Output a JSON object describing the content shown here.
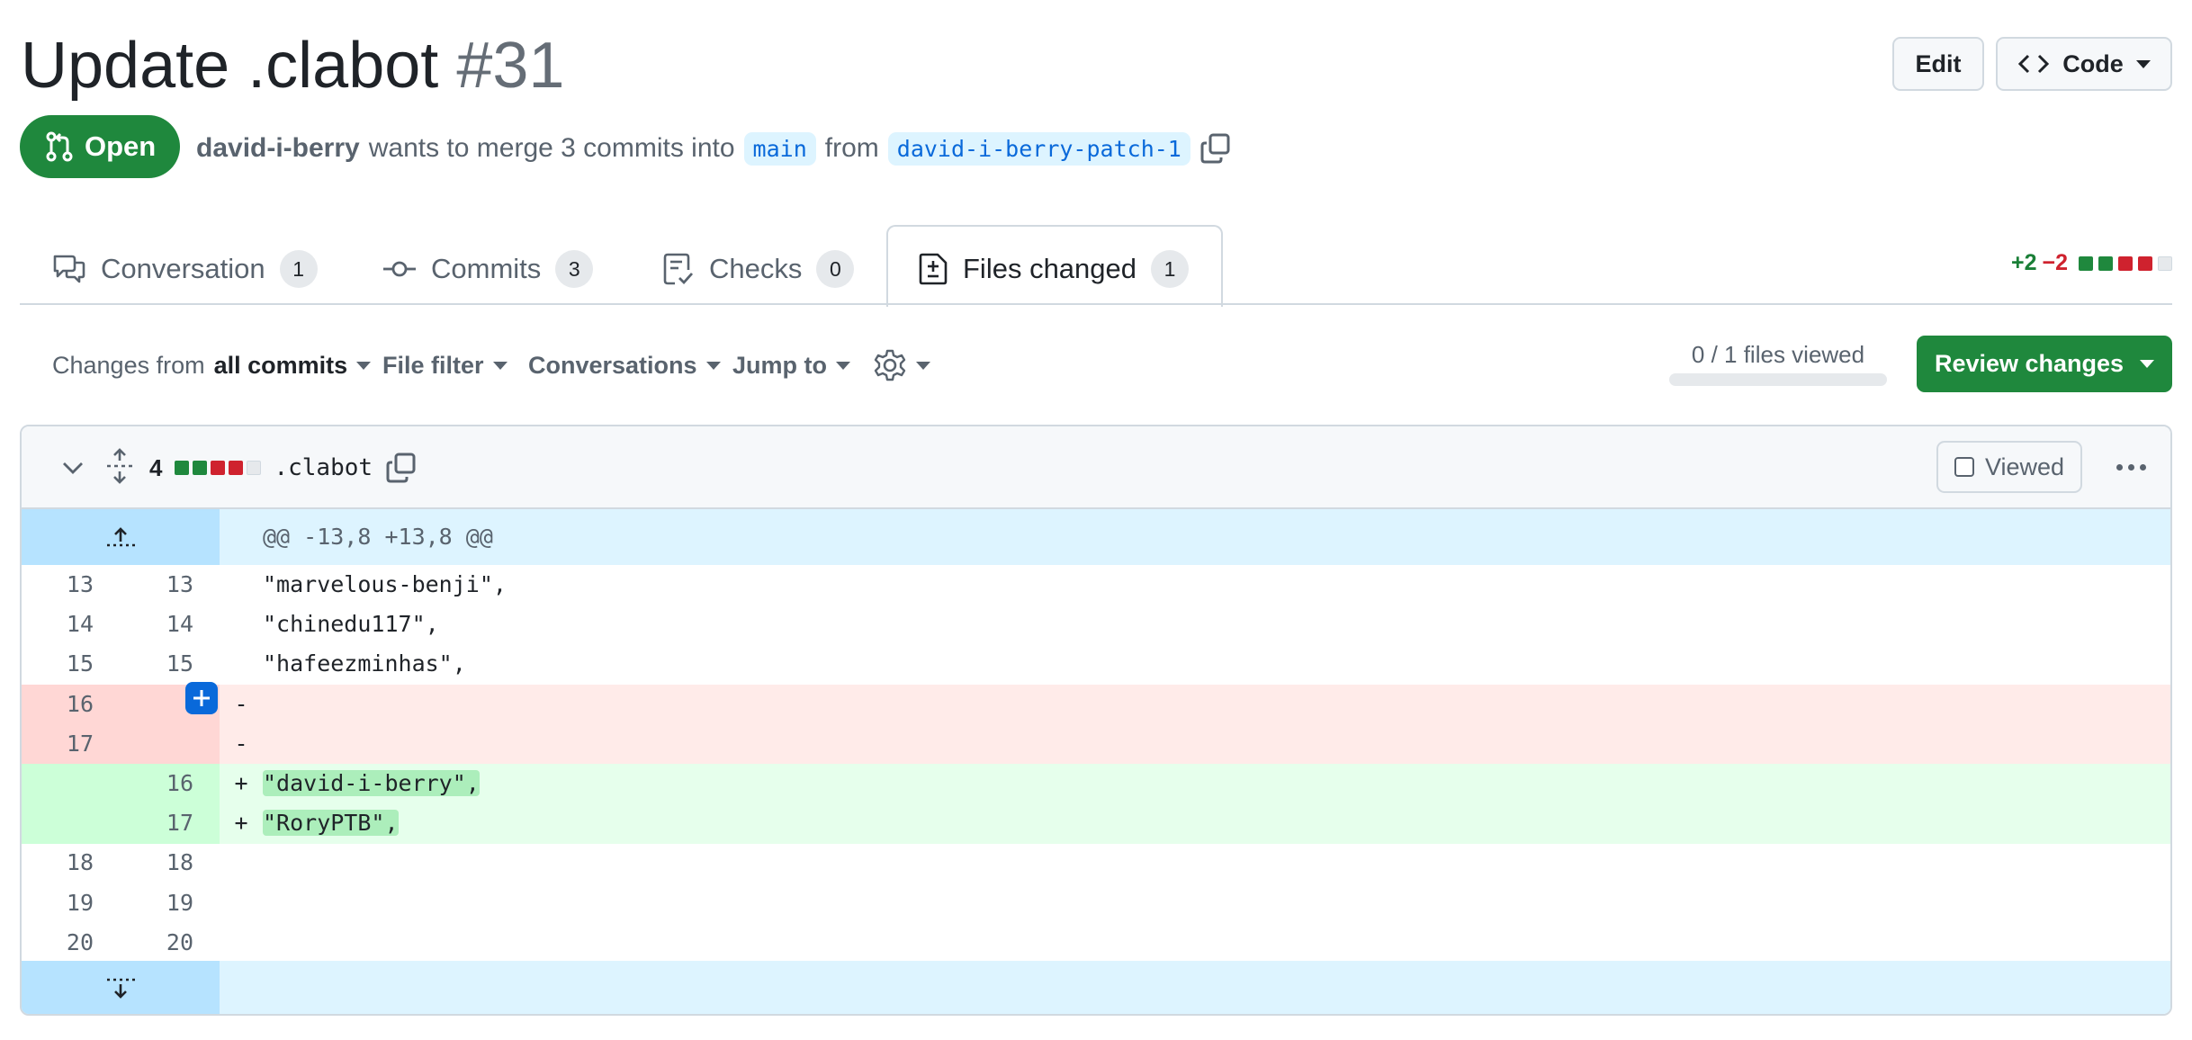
{
  "pr": {
    "title": "Update .clabot",
    "number": "#31",
    "state": "Open",
    "author": "david-i-berry",
    "merge_text": "wants to merge 3 commits into",
    "base_branch": "main",
    "from_text": "from",
    "head_branch": "david-i-berry-patch-1"
  },
  "header_buttons": {
    "edit": "Edit",
    "code": "Code"
  },
  "tabs": [
    {
      "label": "Conversation",
      "count": "1"
    },
    {
      "label": "Commits",
      "count": "3"
    },
    {
      "label": "Checks",
      "count": "0"
    },
    {
      "label": "Files changed",
      "count": "1"
    }
  ],
  "diffstat": {
    "additions": "+2",
    "deletions": "−2"
  },
  "toolbar": {
    "changes_prefix": "Changes from",
    "changes_value": "all commits",
    "file_filter": "File filter",
    "conversations": "Conversations",
    "jump_to": "Jump to",
    "files_viewed": "0 / 1 files viewed",
    "files_viewed_fraction": 0,
    "review_button": "Review changes"
  },
  "file": {
    "changes": "4",
    "name": ".clabot",
    "viewed_label": "Viewed",
    "hunk_header": "@@ -13,8 +13,8 @@",
    "lines": [
      {
        "type": "ctx",
        "old": "13",
        "new": "13",
        "mark": "",
        "code": "\"marvelous-benji\","
      },
      {
        "type": "ctx",
        "old": "14",
        "new": "14",
        "mark": "",
        "code": "\"chinedu117\","
      },
      {
        "type": "ctx",
        "old": "15",
        "new": "15",
        "mark": "",
        "code": "\"hafeezminhas\","
      },
      {
        "type": "del",
        "old": "16",
        "new": "",
        "mark": "-",
        "code": ""
      },
      {
        "type": "del",
        "old": "17",
        "new": "",
        "mark": "-",
        "code": ""
      },
      {
        "type": "add",
        "old": "",
        "new": "16",
        "mark": "+",
        "code": "\"david-i-berry\","
      },
      {
        "type": "add",
        "old": "",
        "new": "17",
        "mark": "+",
        "code": "\"RoryPTB\","
      },
      {
        "type": "ctx",
        "old": "18",
        "new": "18",
        "mark": "",
        "code": ""
      },
      {
        "type": "ctx",
        "old": "19",
        "new": "19",
        "mark": "",
        "code": ""
      },
      {
        "type": "ctx",
        "old": "20",
        "new": "20",
        "mark": "",
        "code": ""
      }
    ]
  },
  "colors": {
    "green": "#1f883d",
    "red": "#cf222e",
    "accent": "#0969da"
  }
}
